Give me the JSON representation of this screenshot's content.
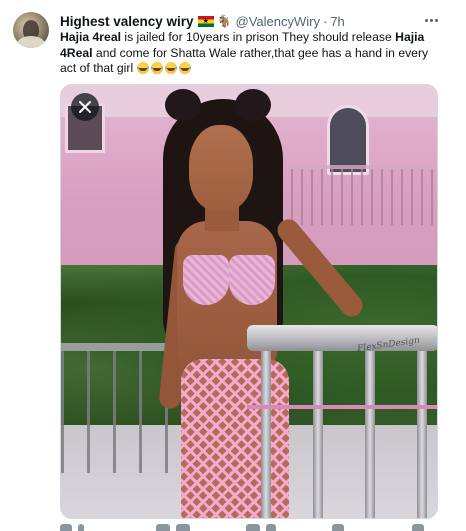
{
  "tweet": {
    "display_name": "Highest valency wiry",
    "flag_emoji": "ghana-flag",
    "extra_emoji": "goat-icon",
    "handle": "@ValencyWiry",
    "separator": "·",
    "time": "7h",
    "text_parts": [
      {
        "t": "Hajia 4real",
        "bold": true
      },
      {
        "t": " is jailed for 10years in prison They should release ",
        "bold": false
      },
      {
        "t": "Hajia 4Real",
        "bold": true
      },
      {
        "t": " and come for Shatta Wale rather,that gee has a hand in every act of that girl ",
        "bold": false
      }
    ],
    "emoji_count": 4,
    "emoji_name": "face-with-tears-of-joy",
    "media": {
      "watermark": "FlexSnDesign",
      "close_icon": "close-icon"
    }
  },
  "colors": {
    "text": "#0f1419",
    "muted": "#536471",
    "border": "#cfd9de",
    "background": "#ffffff"
  }
}
